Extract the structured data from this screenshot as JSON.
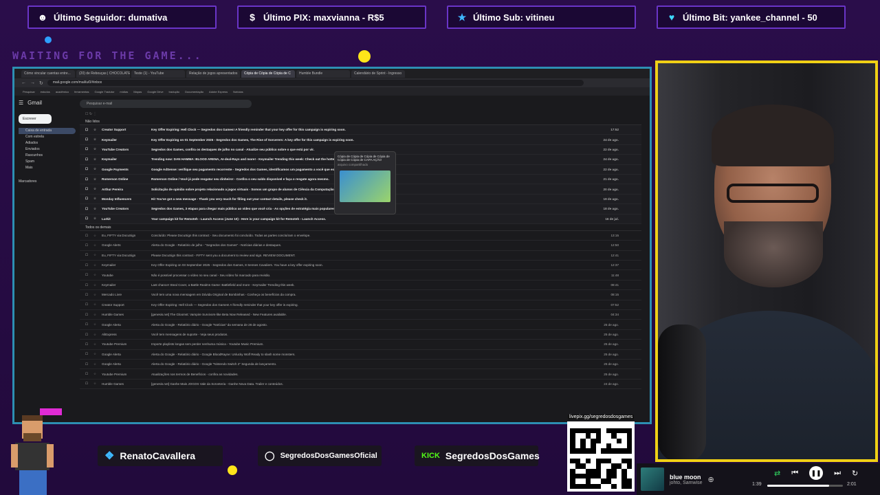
{
  "overlay": {
    "alerts": [
      {
        "icon": "user-icon",
        "label": "Último Seguidor: dumativa"
      },
      {
        "icon": "dollar-icon",
        "label": "Último PIX: maxvianna - R$5"
      },
      {
        "icon": "star-icon",
        "label": "Último Sub: vitineu"
      },
      {
        "icon": "heart-icon",
        "label": "Último Bit: yankee_channel - 50"
      }
    ],
    "waiting_text": "WAITING FOR THE GAME...",
    "socials": {
      "twitter": "RenatoCavallera",
      "instagram": "SegredosDosGamesOficial",
      "kick": "SegredosDosGames",
      "kick_logo": "KICK"
    },
    "qr_url": "livepix.gg/segredosdosgames"
  },
  "browser": {
    "tabs": [
      "Cómo vincular cuentas entre...",
      "(20) de Rebouças | CHOCOLATE",
      "Teste (1) - YouTube",
      "Relação de jogos apresentados",
      "Cópia de Cópia de Cópia de C",
      "Humble Bundle",
      "Calendário de Sprint - Ingresso"
    ],
    "active_tab": 4,
    "url": "mail.google.com/mail/u/0/#inbox",
    "bookmarks": [
      "Pesquisar",
      "estudos",
      "acadêmico",
      "ferramentas",
      "Google Tradutor",
      "mídias",
      "Mapas",
      "Google Drive",
      "tradução",
      "Documentação",
      "Adobe Express",
      "Notícias"
    ]
  },
  "gmail": {
    "logo": "Gmail",
    "search_placeholder": "Pesquisar e-mail",
    "compose": "Escrever",
    "folders": [
      {
        "label": "Caixa de entrada",
        "count": "",
        "active": true
      },
      {
        "label": "Com estrela",
        "count": ""
      },
      {
        "label": "Adiados",
        "count": ""
      },
      {
        "label": "Enviados",
        "count": ""
      },
      {
        "label": "Rascunhos",
        "count": "1"
      },
      {
        "label": "Spam",
        "count": ""
      },
      {
        "label": "Mais",
        "count": ""
      }
    ],
    "labels_title": "Marcadores",
    "section_unread": "Não lidos",
    "section_all": "Todos os demais",
    "unread": [
      {
        "sender": "Creator Support",
        "subject": "Key Offer Expiring: Hell Clock — Segredos dos Games! A friendly reminder that your key offer for this campaign is expiring soon.",
        "date": "17:52"
      },
      {
        "sender": "Keymailer",
        "subject": "Key Offer Expiring on 01 September 2025 - Segredos dos Games, The Rise of Sorcerers: A key offer for this campaign is expiring soon.",
        "date": "24 de ago."
      },
      {
        "sender": "YouTube Creators",
        "subject": "Segredos dos Games, confira os destaques de julho no canal - Atualize seu público sobre o que está por vir.",
        "date": "22 de ago."
      },
      {
        "sender": "Keymailer",
        "subject": "Trending now: DAN HAMMA: BLOOD ARENA, AI-deal-Rays and more! - Keymailer Trending this week: Check out the hottest titles.",
        "date": "24 de ago."
      },
      {
        "sender": "Google Payments",
        "subject": "Google AdSense: verifique seu pagamento recorrente - Segredos dos Games, identificamos um pagamento a você que está pendente.",
        "date": "22 de ago."
      },
      {
        "sender": "Romerson Online",
        "subject": "Romerson Online / Você já pode resgatar seu dinheiro! - Confira o seu saldo disponível e faça o resgate agora mesmo.",
        "date": "21 de ago."
      },
      {
        "sender": "Arthur Pereira",
        "subject": "Solicitação de opinião sobre projeto relacionado a jogos virtuais - Somos um grupo de alunos de Ciência da Computação.",
        "date": "20 de ago."
      },
      {
        "sender": "Monday Influencers",
        "subject": "Hi! You've got a new message - Thank you very much for filling out your contact details, please check it.",
        "date": "19 de ago."
      },
      {
        "sender": "YouTube Creators",
        "subject": "Segredos dos Games, 3 etapas para chegar mais público ao vídeo que você cria - As opções de estratégia mais populares.",
        "date": "18 de ago."
      },
      {
        "sender": "Lurkit",
        "subject": "Your campaign kit for Remoteh - Launch Access (June 10) - Here is your campaign kit for Remoteh - Launch Access.",
        "date": "16 de jul."
      }
    ],
    "all": [
      {
        "sender": "Eu, FIFTY via DocuSign",
        "subject": "Concluído: Please DocuSign this contract - Seu documento foi concluído. Todas as partes concluíram o envelope.",
        "date": "13:15"
      },
      {
        "sender": "Google Alerts",
        "subject": "Alerta do Google - Relatório de julho - \"Segredos dos Games\" - Notícias diárias e destaques.",
        "date": "12:50"
      },
      {
        "sender": "Eu, FIFTY via DocuSign",
        "subject": "Please DocuSign this contract - FIFTY sent you a document to review and sign. REVIEW DOCUMENT.",
        "date": "12:41"
      },
      {
        "sender": "Keymailer",
        "subject": "Key Offer Expiring on 03 September 2025 - Segredos dos Games, 8 Senses Cavaliers. You have a key offer expiring soon.",
        "date": "12:37"
      },
      {
        "sender": "Youtube",
        "subject": "Não é possível processar o vídeo no seu canal - Seu vídeo foi marcado para revisão.",
        "date": "11:48"
      },
      {
        "sender": "Keymailer",
        "subject": "Last chance! Steal Cover, a Battle Realms Game: Battlefield and more - Keymailer Trending this week.",
        "date": "08:41"
      },
      {
        "sender": "Mercado Livre",
        "subject": "Você tem uma nova mensagem em Dúvida Original de Bombinhas - Conheça os benefícios da compra.",
        "date": "08:15"
      },
      {
        "sender": "Creator Support",
        "subject": "Key Offer Expiring: Hell Clock — Segredos dos Games! A friendly reminder that your key offer is expiring.",
        "date": "07:52"
      },
      {
        "sender": "Humble Games",
        "subject": "[genesis.net] The Gloomst: Vampire Survivors-like Beta Now Released - New Features available.",
        "date": "04:34"
      },
      {
        "sender": "Google Alerta",
        "subject": "Alerta do Google - Relatório diário - Google \"Notícias\" da semana de 26 de agosto.",
        "date": "25 de ago."
      },
      {
        "sender": "AliExpress",
        "subject": "Você tem mensagens de suporte - Veja seus produtos.",
        "date": "25 de ago."
      },
      {
        "sender": "Youtube Premium",
        "subject": "Importe playlists longas sem perder nenhuma música - Youtube Music Premium.",
        "date": "25 de ago."
      },
      {
        "sender": "Google Alerta",
        "subject": "Alerta do Google - Relatório diário - Google BloodRayne: Unlucky Wolf Ready to slash some monsters.",
        "date": "25 de ago."
      },
      {
        "sender": "Google Alerta",
        "subject": "Alerta do Google - Relatório diário - Google \"Nintendo Switch 2\" Segunda de lançamento.",
        "date": "25 de ago."
      },
      {
        "sender": "Youtube Premium",
        "subject": "Atualizações nos termos de Benefícios - confira as novidades.",
        "date": "25 de ago."
      },
      {
        "sender": "Humble Games",
        "subject": "[genesis.net] Ganhe Mais JOGOS Vale da Sorveteria - Ganhe Nova Data. Trailer e conteúdos.",
        "date": "24 de ago."
      }
    ],
    "tooltip_title": "Cópia de Cópia de Cópia de Cópia de Cópia de Cópia de CAPA AÇÃO",
    "tooltip_sub": "arquivo compartilhado"
  },
  "music": {
    "title": "blue moon",
    "artist": "johto, Samwise",
    "elapsed": "1:39",
    "total": "2:01",
    "progress": 0.82
  }
}
